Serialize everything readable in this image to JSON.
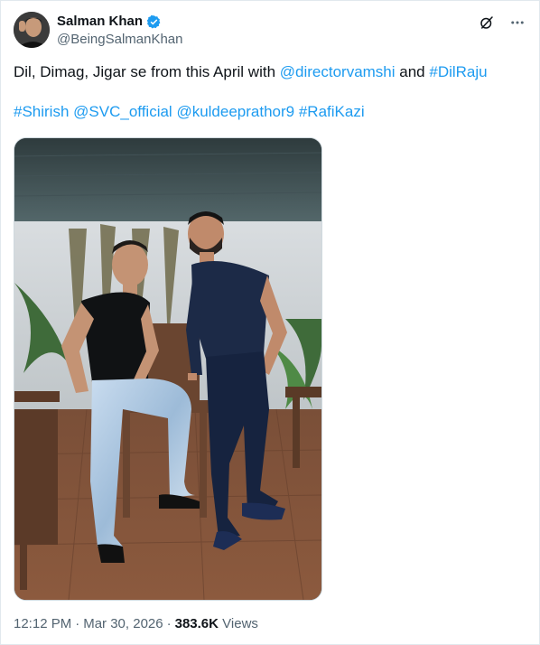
{
  "author": {
    "display_name": "Salman Khan",
    "handle": "@BeingSalmanKhan",
    "verified_icon": "verified-badge-icon",
    "verified_color": "#1d9bf0"
  },
  "header_actions": {
    "grok_icon": "grok-icon",
    "more_icon": "more-icon"
  },
  "tweet": {
    "line1_text": "Dil, Dimag, Jigar se from this April with ",
    "mention_director": "@directorvamshi",
    "and_text": " and ",
    "hashtag_dilraju": "#DilRaju",
    "hashtag_shirish": "#Shirish",
    "mention_svc": "@SVC_official",
    "mention_kuldeep": "@kuldeeprathor9",
    "hashtag_rafikazi": "#RafiKazi"
  },
  "media": {
    "type": "photo"
  },
  "meta": {
    "time": "12:12 PM",
    "separator": "·",
    "date": "Mar 30, 2026",
    "views_count": "383.6K",
    "views_label": "Views"
  },
  "colors": {
    "link": "#1d9bf0",
    "text": "#0f1419",
    "secondary": "#536471"
  }
}
